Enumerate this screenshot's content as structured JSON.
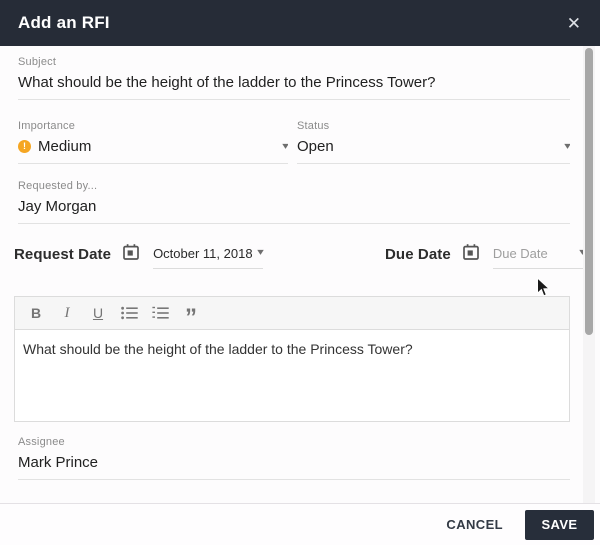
{
  "modal": {
    "title": "Add an RFI"
  },
  "icons": {
    "close": "✕",
    "dropdown_arrow": "▾",
    "importance_exclamation": "!",
    "quote": "”"
  },
  "fields": {
    "subject": {
      "label": "Subject",
      "value": "What should be the height of the ladder to the Princess Tower?"
    },
    "importance": {
      "label": "Importance",
      "value": "Medium",
      "level_color": "#F5A623"
    },
    "status": {
      "label": "Status",
      "value": "Open"
    },
    "requested_by": {
      "label": "Requested by...",
      "value": "Jay Morgan"
    },
    "request_date": {
      "label": "Request Date",
      "value": "October 11, 2018"
    },
    "due_date": {
      "label": "Due Date",
      "placeholder": "Due Date"
    },
    "assignee": {
      "label": "Assignee",
      "value": "Mark Prince"
    }
  },
  "editor": {
    "toolbar": [
      {
        "name": "bold",
        "glyph": "B"
      },
      {
        "name": "italic",
        "glyph": "I"
      },
      {
        "name": "underline",
        "glyph": "U"
      },
      {
        "name": "bullet-list"
      },
      {
        "name": "ordered-list"
      },
      {
        "name": "quote",
        "glyph": "”"
      }
    ],
    "content": "What should be the height of the ladder to the Princess Tower?"
  },
  "footer": {
    "cancel_label": "CANCEL",
    "save_label": "SAVE"
  },
  "colors": {
    "header_bg": "#262C37",
    "save_button_bg": "#272E3A",
    "accent_orange": "#F5A623",
    "underline_gray": "#E2E2E2"
  }
}
